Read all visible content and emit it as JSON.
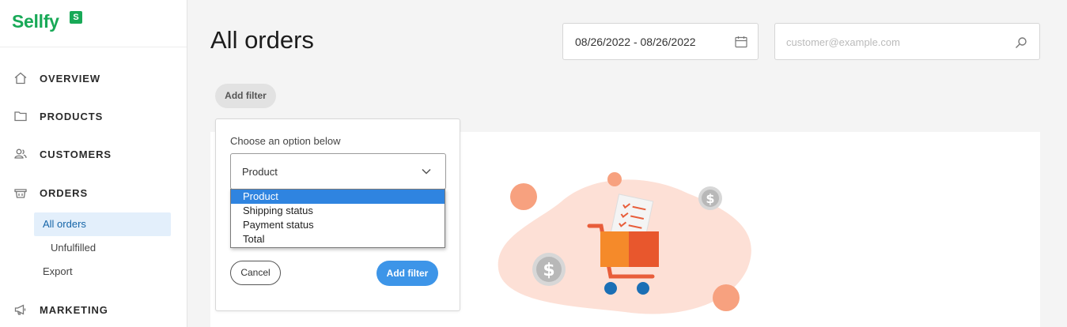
{
  "brand": {
    "name": "Sellfy",
    "badge": "S",
    "color": "#18a957"
  },
  "sidebar": {
    "items": [
      {
        "label": "OVERVIEW",
        "icon": "home-icon"
      },
      {
        "label": "PRODUCTS",
        "icon": "folder-icon"
      },
      {
        "label": "CUSTOMERS",
        "icon": "users-icon"
      },
      {
        "label": "ORDERS",
        "icon": "basket-icon"
      },
      {
        "label": "MARKETING",
        "icon": "megaphone-icon"
      }
    ],
    "orders_sub": [
      {
        "label": "All orders",
        "active": true
      },
      {
        "label": "Unfulfilled",
        "active": false
      },
      {
        "label": "Export",
        "active": false
      }
    ]
  },
  "header": {
    "title": "All orders",
    "date_range": "08/26/2022 - 08/26/2022",
    "search_placeholder": "customer@example.com"
  },
  "filters": {
    "add_filter_label": "Add filter",
    "popover": {
      "prompt": "Choose an option below",
      "selected": "Product",
      "options": [
        "Product",
        "Shipping status",
        "Payment status",
        "Total"
      ],
      "cancel_label": "Cancel",
      "add_label": "Add filter"
    }
  },
  "colors": {
    "accent_blue": "#3d95e8",
    "selection_blue": "#2f84e0",
    "illustration_orange": "#f0862a",
    "illustration_peach": "#fde0d6"
  }
}
